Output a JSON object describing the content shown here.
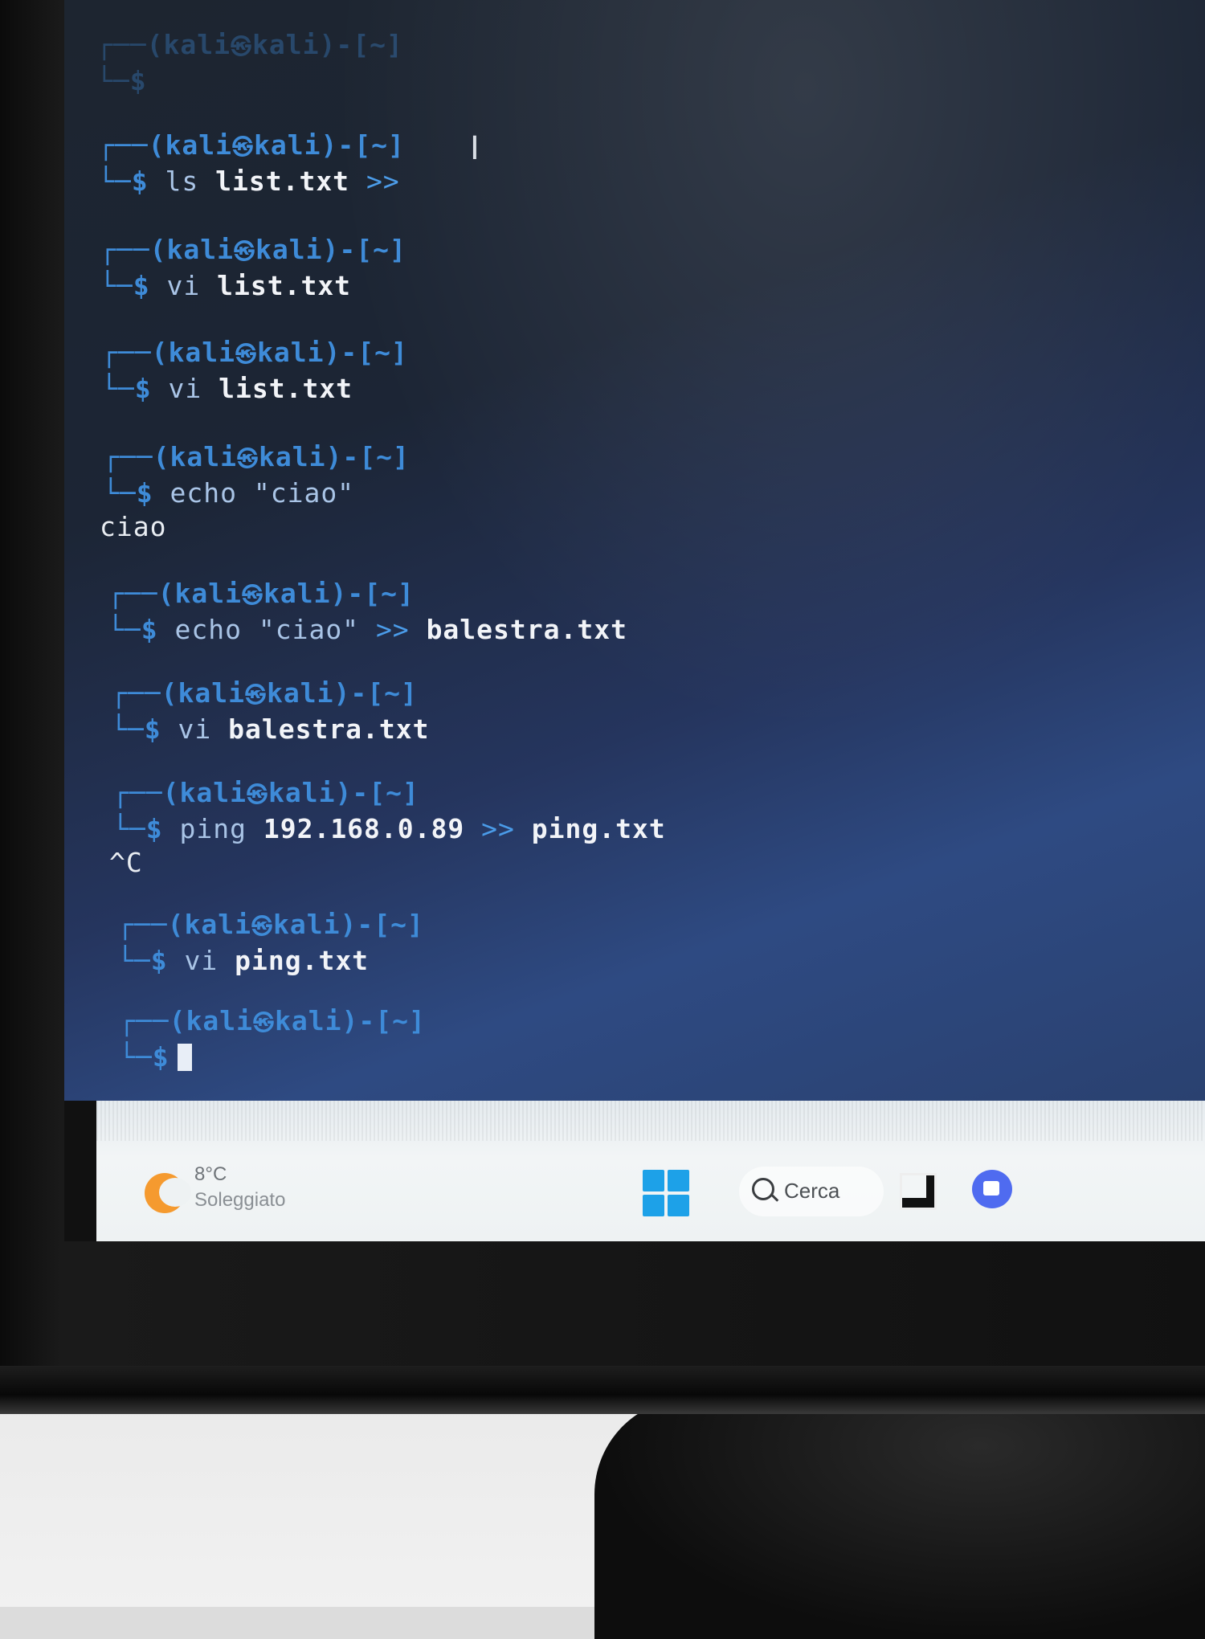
{
  "terminal": {
    "blocks": [
      {
        "user": "kali",
        "host": "kali",
        "dir": "~",
        "cmd": "",
        "args": "",
        "faded": true
      },
      {
        "user": "kali",
        "host": "kali",
        "dir": "~",
        "cmd": "ls",
        "op": ">>",
        "args": "list.txt",
        "faded": false
      },
      {
        "user": "kali",
        "host": "kali",
        "dir": "~",
        "cmd": "vi",
        "args": "list.txt"
      },
      {
        "user": "kali",
        "host": "kali",
        "dir": "~",
        "cmd": "vi",
        "args": "list.txt"
      },
      {
        "user": "kali",
        "host": "kali",
        "dir": "~",
        "cmd": "echo",
        "args": "\"ciao\"",
        "output": "ciao"
      },
      {
        "user": "kali",
        "host": "kali",
        "dir": "~",
        "cmd": "echo",
        "args": "\"ciao\"",
        "op": ">>",
        "args2": "balestra.txt"
      },
      {
        "user": "kali",
        "host": "kali",
        "dir": "~",
        "cmd": "vi",
        "args": "balestra.txt"
      },
      {
        "user": "kali",
        "host": "kali",
        "dir": "~",
        "cmd": "ping",
        "args": "192.168.0.89",
        "op": ">>",
        "args2": "ping.txt",
        "output": "^C"
      },
      {
        "user": "kali",
        "host": "kali",
        "dir": "~",
        "cmd": "vi",
        "args": "ping.txt"
      },
      {
        "user": "kali",
        "host": "kali",
        "dir": "~",
        "cmd": "",
        "args": "",
        "cursor": true
      }
    ],
    "prompt_prefix": "┌──(",
    "prompt_at": "㉿",
    "prompt_mid": ")-[",
    "prompt_suffix": "]",
    "prompt_dollar": "└─$",
    "colors": {
      "prompt": "#3e8bd8",
      "command": "#a9c4e6",
      "arguments": "#f2f4f8"
    }
  },
  "taskbar": {
    "weather": {
      "temp": "8°C",
      "desc": "Soleggiato"
    },
    "search_label": "Cerca",
    "icons": [
      "weather-icon",
      "windows-start-icon",
      "search-icon",
      "task-view-icon",
      "chat-icon"
    ]
  }
}
